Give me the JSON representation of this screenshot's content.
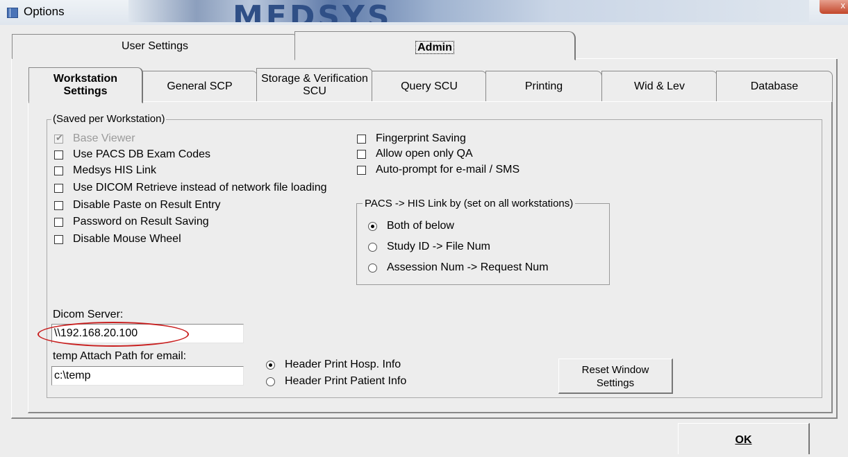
{
  "window": {
    "title": "Options",
    "banner_text": "MEDSYS",
    "close_glyph": "x"
  },
  "top_tabs": {
    "user_settings": "User Settings",
    "admin": "Admin",
    "active": "Admin"
  },
  "inner_tabs": {
    "workstation_line1": "Workstation",
    "workstation_line2": "Settings",
    "general_scp": "General SCP",
    "storage_line1": "Storage & Verification",
    "storage_line2": "SCU",
    "query_scu": "Query SCU",
    "printing": "Printing",
    "wid_lev": "Wid & Lev",
    "database": "Database",
    "active": "Workstation Settings"
  },
  "group": {
    "label": "(Saved per Workstation)"
  },
  "checkboxes_left": [
    {
      "label": "Base Viewer",
      "checked": true,
      "disabled": true
    },
    {
      "label": "Use PACS DB Exam Codes",
      "checked": false,
      "disabled": false
    },
    {
      "label": "Medsys HIS Link",
      "checked": false,
      "disabled": false
    },
    {
      "label": "Use DICOM Retrieve instead of network file loading",
      "checked": false,
      "disabled": false
    },
    {
      "label": "Disable Paste on Result Entry",
      "checked": false,
      "disabled": false
    },
    {
      "label": "Password on Result Saving",
      "checked": false,
      "disabled": false
    },
    {
      "label": "Disable Mouse Wheel",
      "checked": false,
      "disabled": false
    }
  ],
  "checkboxes_right": [
    {
      "label": "Fingerprint Saving",
      "checked": false
    },
    {
      "label": "Allow open only QA",
      "checked": false
    },
    {
      "label": "Auto-prompt for e-mail / SMS",
      "checked": false
    }
  ],
  "link_group": {
    "label": "PACS -> HIS Link by (set on all workstations)",
    "options": [
      {
        "label": "Both of below",
        "selected": true
      },
      {
        "label": "Study ID -> File Num",
        "selected": false
      },
      {
        "label": "Assession Num -> Request Num",
        "selected": false
      }
    ]
  },
  "dicom_server": {
    "label": "Dicom Server:",
    "value": "\\\\192.168.20.100"
  },
  "temp_path": {
    "label": "temp Attach Path for email:",
    "value": "c:\\temp"
  },
  "header_print": [
    {
      "label": "Header Print Hosp. Info",
      "selected": true
    },
    {
      "label": "Header Print Patient Info",
      "selected": false
    }
  ],
  "buttons": {
    "reset_line1": "Reset Window",
    "reset_line2": "Settings",
    "ok": "OK"
  },
  "colors": {
    "annotation_ellipse": "#c81e1e",
    "dialog_background": "#ededed"
  }
}
